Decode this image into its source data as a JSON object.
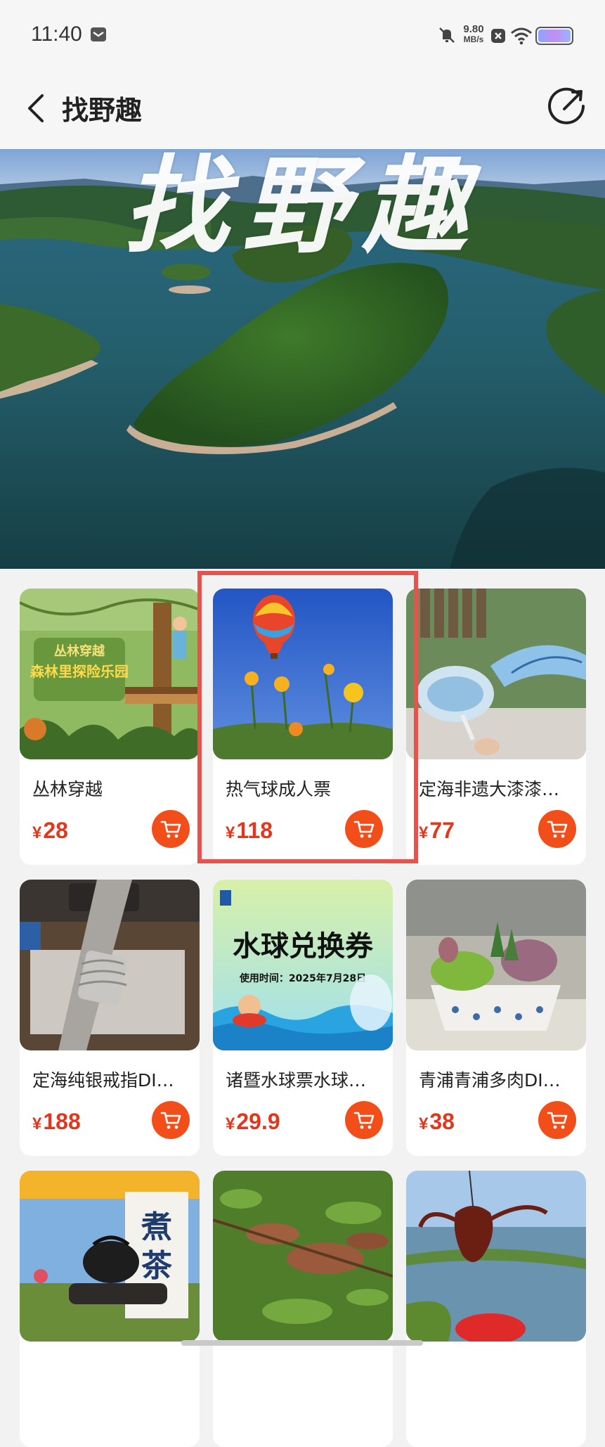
{
  "status_bar": {
    "time": "11:40",
    "net_speed_value": "9.80",
    "net_speed_unit": "MB/s",
    "icons": [
      "mail-icon",
      "mute-icon",
      "close-box-icon",
      "wifi-icon",
      "battery-icon"
    ]
  },
  "header": {
    "title": "找野趣",
    "back_icon": "back-arrow-icon",
    "share_icon": "share-icon"
  },
  "banner": {
    "title_text": "找野趣"
  },
  "products": [
    {
      "name": "丛林穿越",
      "currency": "¥",
      "price": "28",
      "thumb_texts": [
        "丛林穿越",
        "森林里探险乐园"
      ]
    },
    {
      "name": "热气球成人票",
      "currency": "¥",
      "price": "118",
      "thumb_texts": []
    },
    {
      "name": "定海非遗大漆漆…",
      "currency": "¥",
      "price": "77",
      "thumb_texts": []
    },
    {
      "name": "定海纯银戒指DI…",
      "currency": "¥",
      "price": "188",
      "thumb_texts": []
    },
    {
      "name": "诸暨水球票水球…",
      "currency": "¥",
      "price": "29.9",
      "thumb_texts": [
        "水球兑换券",
        "使用时间：2025年7月28日"
      ]
    },
    {
      "name": "青浦青浦多肉DI…",
      "currency": "¥",
      "price": "38",
      "thumb_texts": []
    },
    {
      "name": "",
      "currency": "",
      "price": "",
      "thumb_texts": [
        "煮",
        "茶"
      ]
    },
    {
      "name": "",
      "currency": "",
      "price": "",
      "thumb_texts": []
    },
    {
      "name": "",
      "currency": "",
      "price": "",
      "thumb_texts": []
    }
  ],
  "colors": {
    "price": "#e2371c",
    "cart_button": "#f24e1a",
    "highlight": "#e8524d"
  }
}
